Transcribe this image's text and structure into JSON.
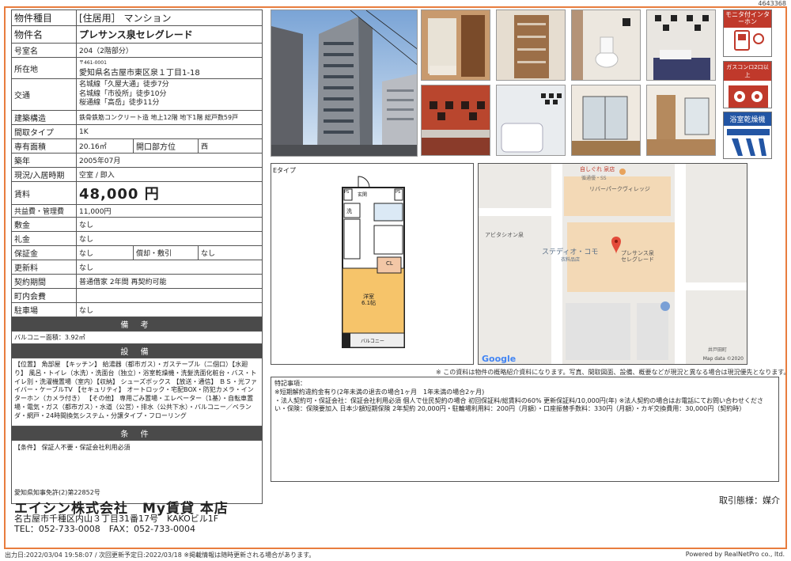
{
  "doc_id": "4643368",
  "property": {
    "type_label": "物件種目",
    "type_value": "[住居用］ マンション",
    "name_label": "物件名",
    "name_value": "プレサンス泉セレグレード",
    "room_label": "号室名",
    "room_value": "204（2階部分）",
    "addr_label": "所在地",
    "zip": "〒461-0001",
    "addr_value": "愛知県名古屋市東区泉１丁目1-18",
    "transport_label": "交通",
    "transport": [
      "名城線「久屋大通」徒歩7分",
      "名城線「市役所」徒歩10分",
      "桜通線「高岳」徒歩11分"
    ],
    "structure_label": "建築構造",
    "structure_value": "鉄骨鉄筋コンクリート造 地上12階 地下1階 総戸数59戸",
    "layout_label": "間取タイプ",
    "layout_value": "1K",
    "area_label": "専有面積",
    "area_value": "20.16㎡",
    "direction_label": "開口部方位",
    "direction_value": "西",
    "built_label": "築年",
    "built_value": "2005年07月",
    "status_label": "現況/入居時期",
    "status_value": "空室 / 即入",
    "rent_label": "賃料",
    "rent_value": "48,000 円",
    "fee_label": "共益費・管理費",
    "fee_value": "11,000円",
    "deposit_label": "敷金",
    "deposit_value": "なし",
    "keymoney_label": "礼金",
    "keymoney_value": "なし",
    "hoshoukin_label": "保証金",
    "hoshoukin_value": "なし",
    "shokyaku_label": "償却・敷引",
    "shokyaku_value": "なし",
    "renewal_label": "更新料",
    "renewal_value": "なし",
    "contract_label": "契約期間",
    "contract_value": "普通借家 2年間 再契約可能",
    "community_label": "町内会費",
    "community_value": "",
    "parking_label": "駐車場",
    "parking_value": "なし"
  },
  "sections": {
    "biko_title": "備 考",
    "biko_text": "バルコニー面積：3.92㎡",
    "setsubi_title": "設 備",
    "setsubi_text": "【位置】 角部屋 【キッチン】 給湯器（都市ガス）・ガステーブル（二個口）【水廻り】 風呂・トイレ（水洗）・洗面台（独立）・浴室乾燥機・洗髪洗面化粧台・バス・トイレ別・洗濯機置場（室内）【収納】 シューズボックス 【放送・通信】 ＢＳ・光ファイバー・ケーブルTV 【セキュリティ】 オートロック・宅配BOX・防犯カメラ・インターホン（カメラ付き） 【その他】 専用ごみ置場・エレベーター（1基）・自転車置場・電気・ガス（都市ガス）・水道（公営）・排水（公共下水）・バルコニー／ベランダ・網戸・24時間換気システム・分譲タイプ・フローリング",
    "jouken_title": "条 件",
    "jouken_text": "【条件】 保証人不要・保証会社利用必須"
  },
  "badges": [
    "モニタ付インターホン",
    "ガスコンロ2口以上",
    "浴室乾燥機"
  ],
  "floorplan": {
    "type_label": "Eタイプ",
    "room_label": "洋室",
    "room_size": "6.1帖",
    "entry": "玄関",
    "wash": "洗",
    "cl": "CL",
    "balcony": "バルコニー",
    "ps": "PS"
  },
  "map": {
    "labels": [
      "自しぐれ 泉店",
      "循通優・SS",
      "リバーパークヴィレッジ",
      "アビタシオン泉",
      "ステディオ・コモ",
      "衣料品店",
      "プレサンス泉",
      "セレグレード",
      "井戸田町"
    ],
    "google": "Google",
    "mapdata": "Map data ©2020"
  },
  "disclaimer": "※ この資料は物件の概略紹介資料になります。写真、間取図面、設備、概要などが現況と異なる場合は現況優先となります。",
  "special": {
    "title": "特記事項：",
    "lines": [
      "※短期解約違約金有り(2年未満の退去の場合1ヶ月　1年未満の場合2ヶ月)",
      "・法人契約可・保証会社：保証会社利用必須 個人で住民契約の場合 初回保証料/総賃料の60% 更新保証料/10,000円(年) ※法人契約の場合はお電話にてお問い合わせください・保険：保険要加入 日本少額短期保険 2年契約 20,000円・駐輪場利用料：200円（月額）・口座振替手数料：330円（月額）・カギ交換費用：30,000円（契約時）"
    ]
  },
  "company": {
    "license": "愛知県知事免許(2)第22852号",
    "name": "エイシン株式会社　My賃貸 本店",
    "address": "名古屋市千種区内山３丁目31番17号　KAKOビル1F",
    "tel": "TEL：052-733-0008　FAX：052-733-0004",
    "deal": "取引態様：媒介"
  },
  "footer": {
    "left": "出力日:2022/03/04 19:58:07 / 次回更新予定日:2022/03/18 ※掲載情報は随時更新される場合があります。",
    "right": "Powered by RealNetPro co., ltd."
  },
  "colors": {
    "frame": "#e87d3e",
    "section": "#4a4a4a",
    "floor_room": "#f6c46a",
    "cl": "#f3c7a6"
  }
}
